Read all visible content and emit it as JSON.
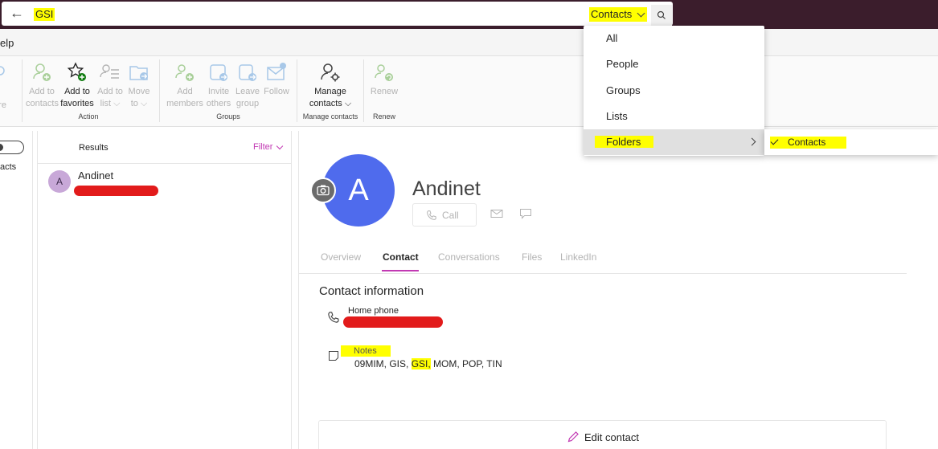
{
  "search": {
    "query": "GSI",
    "scope_label": "Contacts"
  },
  "menu": {
    "help_label": "elp"
  },
  "ribbon": {
    "partial_label": "ore",
    "groups": {
      "action": "Action",
      "groups": "Groups",
      "manage_contacts": "Manage contacts",
      "renew": "Renew"
    },
    "buttons": {
      "add_to_contacts": [
        "Add to",
        "contacts"
      ],
      "add_to_favorites": [
        "Add to",
        "favorites"
      ],
      "add_to_list": [
        "Add to",
        "list ⌵"
      ],
      "move_to": [
        "Move",
        "to ⌵"
      ],
      "add_members": [
        "Add",
        "members"
      ],
      "invite_others": [
        "Invite",
        "others"
      ],
      "leave_group": [
        "Leave",
        "group"
      ],
      "follow": [
        "Follow"
      ],
      "manage_contacts": [
        "Manage",
        "contacts ⌵"
      ],
      "renew": [
        "Renew"
      ]
    }
  },
  "leftpane": {
    "label": "acts"
  },
  "results": {
    "title": "Results",
    "filter_label": "Filter",
    "items": [
      {
        "initial": "A",
        "name": "Andinet"
      }
    ]
  },
  "contact": {
    "initial": "A",
    "name": "Andinet",
    "call_label": "Call",
    "tabs": [
      {
        "label": "Overview",
        "active": false
      },
      {
        "label": "Contact",
        "active": true
      },
      {
        "label": "Conversations",
        "active": false
      },
      {
        "label": "Files",
        "active": false
      },
      {
        "label": "LinkedIn",
        "active": false
      }
    ],
    "section_title": "Contact information",
    "home_phone_label": "Home phone",
    "notes_label": "Notes",
    "notes_before": "09MIM, GIS, ",
    "notes_highlight": "GSI,",
    "notes_after": " MOM, POP, TIN",
    "edit_label": "Edit contact"
  },
  "dropdown": {
    "items": [
      "All",
      "People",
      "Groups",
      "Lists",
      "Folders"
    ],
    "submenu_item": "Contacts"
  },
  "colors": {
    "topbar": "#3b1d2c",
    "accent": "#c239b3",
    "avatar": "#4f6bed",
    "highlight": "#ffff00",
    "redaction": "#e21b1b"
  }
}
